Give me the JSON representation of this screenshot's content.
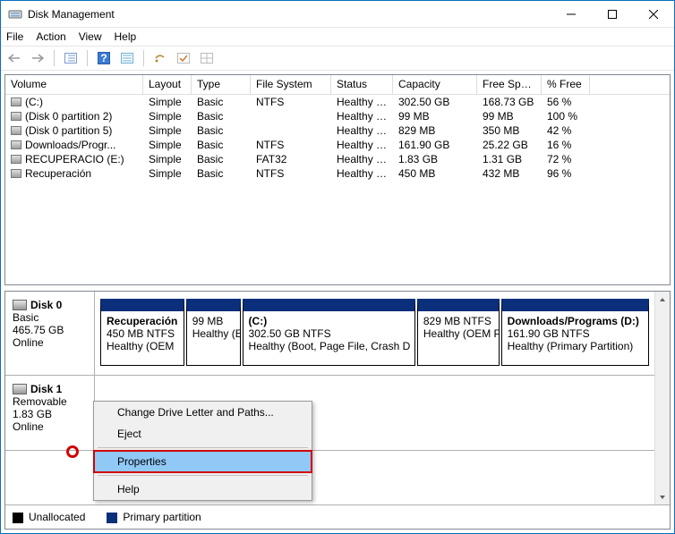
{
  "window": {
    "title": "Disk Management"
  },
  "menus": {
    "file": "File",
    "action": "Action",
    "view": "View",
    "help": "Help"
  },
  "columns": {
    "volume": "Volume",
    "layout": "Layout",
    "type": "Type",
    "fs": "File System",
    "status": "Status",
    "capacity": "Capacity",
    "free": "Free Spa...",
    "pct": "% Free"
  },
  "volumes": [
    {
      "name": "(C:)",
      "layout": "Simple",
      "type": "Basic",
      "fs": "NTFS",
      "status": "Healthy (B...",
      "capacity": "302.50 GB",
      "free": "168.73 GB",
      "pct": "56 %"
    },
    {
      "name": "(Disk 0 partition 2)",
      "layout": "Simple",
      "type": "Basic",
      "fs": "",
      "status": "Healthy (E...",
      "capacity": "99 MB",
      "free": "99 MB",
      "pct": "100 %"
    },
    {
      "name": "(Disk 0 partition 5)",
      "layout": "Simple",
      "type": "Basic",
      "fs": "",
      "status": "Healthy (...",
      "capacity": "829 MB",
      "free": "350 MB",
      "pct": "42 %"
    },
    {
      "name": "Downloads/Progr...",
      "layout": "Simple",
      "type": "Basic",
      "fs": "NTFS",
      "status": "Healthy (P...",
      "capacity": "161.90 GB",
      "free": "25.22 GB",
      "pct": "16 %"
    },
    {
      "name": "RECUPERACIO (E:)",
      "layout": "Simple",
      "type": "Basic",
      "fs": "FAT32",
      "status": "Healthy (A...",
      "capacity": "1.83 GB",
      "free": "1.31 GB",
      "pct": "72 %"
    },
    {
      "name": "Recuperación",
      "layout": "Simple",
      "type": "Basic",
      "fs": "NTFS",
      "status": "Healthy (...",
      "capacity": "450 MB",
      "free": "432 MB",
      "pct": "96 %"
    }
  ],
  "disks": [
    {
      "name": "Disk 0",
      "type": "Basic",
      "size": "465.75 GB",
      "state": "Online",
      "parts": [
        {
          "name": "Recuperación",
          "line1": "450 MB NTFS",
          "line2": "Healthy (OEM",
          "w": 94
        },
        {
          "name": "",
          "line1": "99 MB",
          "line2": "Healthy (E",
          "w": 61,
          "noname": true
        },
        {
          "name": "(C:)",
          "line1": "302.50 GB NTFS",
          "line2": "Healthy (Boot, Page File, Crash D",
          "w": 194
        },
        {
          "name": "",
          "line1": "829 MB NTFS",
          "line2": "Healthy (OEM P",
          "w": 92,
          "noname": true
        },
        {
          "name": "Downloads/Programs  (D:)",
          "line1": "161.90 GB NTFS",
          "line2": "Healthy (Primary Partition)",
          "w": 166
        }
      ]
    },
    {
      "name": "Disk 1",
      "type": "Removable",
      "size": "1.83 GB",
      "state": "Online",
      "parts": []
    }
  ],
  "context_menu": {
    "change": "Change Drive Letter and Paths...",
    "eject": "Eject",
    "properties": "Properties",
    "help": "Help"
  },
  "legend": {
    "unallocated": "Unallocated",
    "primary": "Primary partition"
  }
}
